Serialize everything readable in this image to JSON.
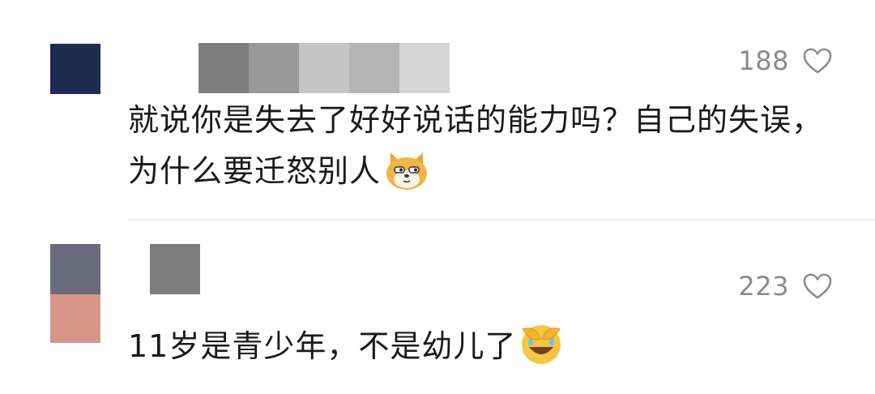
{
  "comments": [
    {
      "text": "就说你是失去了好好说话的能力吗？自己的失误，为什么要迁怒别人",
      "emoji_icon": "doge-emoji",
      "likes": "188",
      "heart_icon": "heart-outline-icon",
      "avatar_colors": [
        "#1e2c4f"
      ]
    },
    {
      "text": "11岁是青少年，不是幼儿了",
      "emoji_icon": "facepalm-laugh-emoji",
      "likes": "223",
      "heart_icon": "heart-outline-icon",
      "avatar_colors": [
        "#6b6b7d",
        "#d8968a"
      ]
    }
  ]
}
